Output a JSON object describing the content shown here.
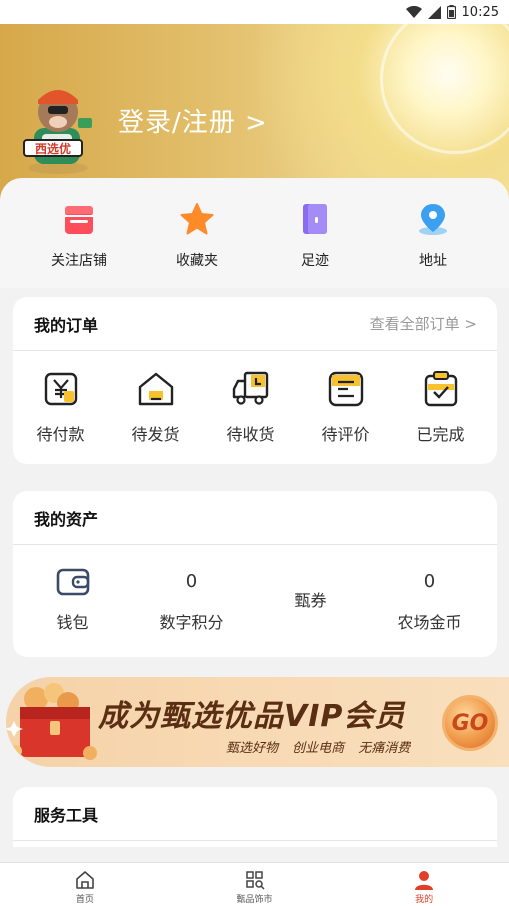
{
  "status_bar": {
    "time": "10:25"
  },
  "header": {
    "login_text": "登录/注册 >"
  },
  "quick_links": [
    {
      "label": "关注店铺",
      "icon": "store-icon"
    },
    {
      "label": "收藏夹",
      "icon": "star-icon"
    },
    {
      "label": "足迹",
      "icon": "footprint-book-icon"
    },
    {
      "label": "地址",
      "icon": "location-pin-icon"
    }
  ],
  "orders": {
    "title": "我的订单",
    "view_all": "查看全部订单 >",
    "items": [
      {
        "label": "待付款",
        "icon": "pending-payment-icon"
      },
      {
        "label": "待发货",
        "icon": "pending-shipment-icon"
      },
      {
        "label": "待收货",
        "icon": "delivery-truck-icon"
      },
      {
        "label": "待评价",
        "icon": "pending-review-icon"
      },
      {
        "label": "已完成",
        "icon": "completed-clipboard-icon"
      }
    ]
  },
  "assets": {
    "title": "我的资产",
    "items": [
      {
        "label": "钱包",
        "value": "",
        "icon": "wallet-icon"
      },
      {
        "label": "数字积分",
        "value": "0"
      },
      {
        "label": "甄券",
        "value": ""
      },
      {
        "label": "农场金币",
        "value": "0"
      }
    ]
  },
  "vip_banner": {
    "title": "成为甄选优品VIP会员",
    "subtitle": "甄选好物 创业电商 无痛消费",
    "go_label": "GO"
  },
  "services": {
    "title": "服务工具"
  },
  "tabbar": [
    {
      "label": "首页",
      "icon": "home-icon",
      "active": false
    },
    {
      "label": "甄品饰市",
      "icon": "grid-search-icon",
      "active": false
    },
    {
      "label": "我的",
      "icon": "user-icon",
      "active": true
    }
  ],
  "colors": {
    "accent_red": "#e0402a",
    "header_gold": "#e2be6a",
    "vip_brown": "#5a2e12"
  }
}
